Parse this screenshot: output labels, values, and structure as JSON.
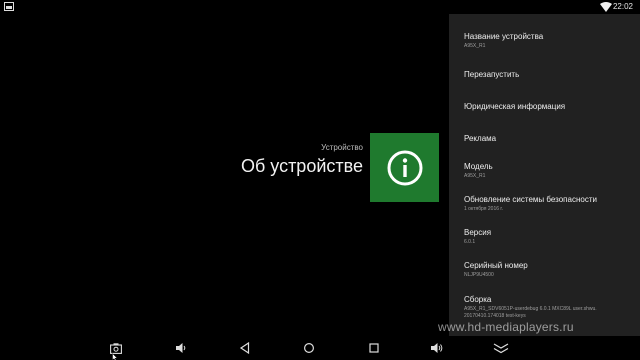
{
  "status_bar": {
    "time": "22:02",
    "left_icon": "screenshot-icon",
    "wifi_icon": "wifi-icon"
  },
  "header": {
    "category": "Устройство",
    "title": "Об устройстве",
    "tile_icon": "info-icon",
    "tile_color": "#1f7a2e"
  },
  "panel": {
    "background": "#212121",
    "items": [
      {
        "title": "Название устройства",
        "subtitle": "A95X_R1"
      },
      {
        "title": "Перезапустить",
        "subtitle": ""
      },
      {
        "title": "Юридическая информация",
        "subtitle": ""
      },
      {
        "title": "Реклама",
        "subtitle": ""
      },
      {
        "title": "Модель",
        "subtitle": "A95X_R1"
      },
      {
        "title": "Обновление системы безопасности",
        "subtitle": "1 октября 2016 г."
      },
      {
        "title": "Версия",
        "subtitle": "6.0.1"
      },
      {
        "title": "Серийный номер",
        "subtitle": "NLJP9U4500"
      },
      {
        "title": "Сборка",
        "subtitle": "A95X_R1_SDV6051P-userdebug 6.0.1 MXC89L user.shwu.",
        "subtitle2": "20170410.174018 test-keys"
      }
    ]
  },
  "nav_bar": {
    "buttons": [
      "screenshot-icon",
      "volume-down-icon",
      "back-icon",
      "home-icon",
      "recents-icon",
      "volume-up-icon",
      "collapse-icon"
    ]
  },
  "watermark": "www.hd-mediaplayers.ru"
}
